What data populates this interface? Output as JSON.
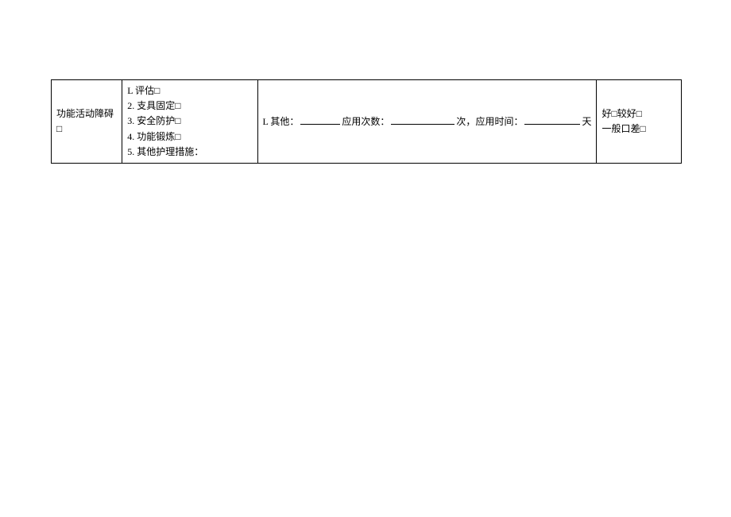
{
  "table": {
    "col1": "功能活动障碍□",
    "measures": [
      "L 评估□",
      "2. 支具固定□",
      "3. 安全防护□",
      "4. 功能锻炼□",
      "5. 其他护理措施："
    ],
    "details": {
      "prefix": "L 其他：",
      "usageCountLabel": "应用次数：",
      "usageCountUnit": "次，",
      "usageTimeLabel": "应用时间：",
      "usageTimeUnit": "天"
    },
    "evaluation": {
      "line1": "好□较好□",
      "line2": "一般口差□"
    }
  }
}
